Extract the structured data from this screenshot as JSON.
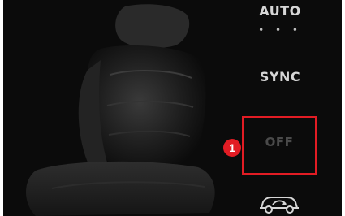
{
  "controls": {
    "auto_label": "AUTO",
    "auto_indicator": "• • •",
    "sync_label": "SYNC",
    "off_label": "OFF",
    "recirculation_icon": "car-recirculation-icon"
  },
  "callout": {
    "number": "1",
    "color": "#e21c24"
  },
  "colors": {
    "background": "#0b0b0b",
    "label": "#d6d6d6",
    "off_dim": "#4a4a4a",
    "highlight": "#e21c24"
  }
}
